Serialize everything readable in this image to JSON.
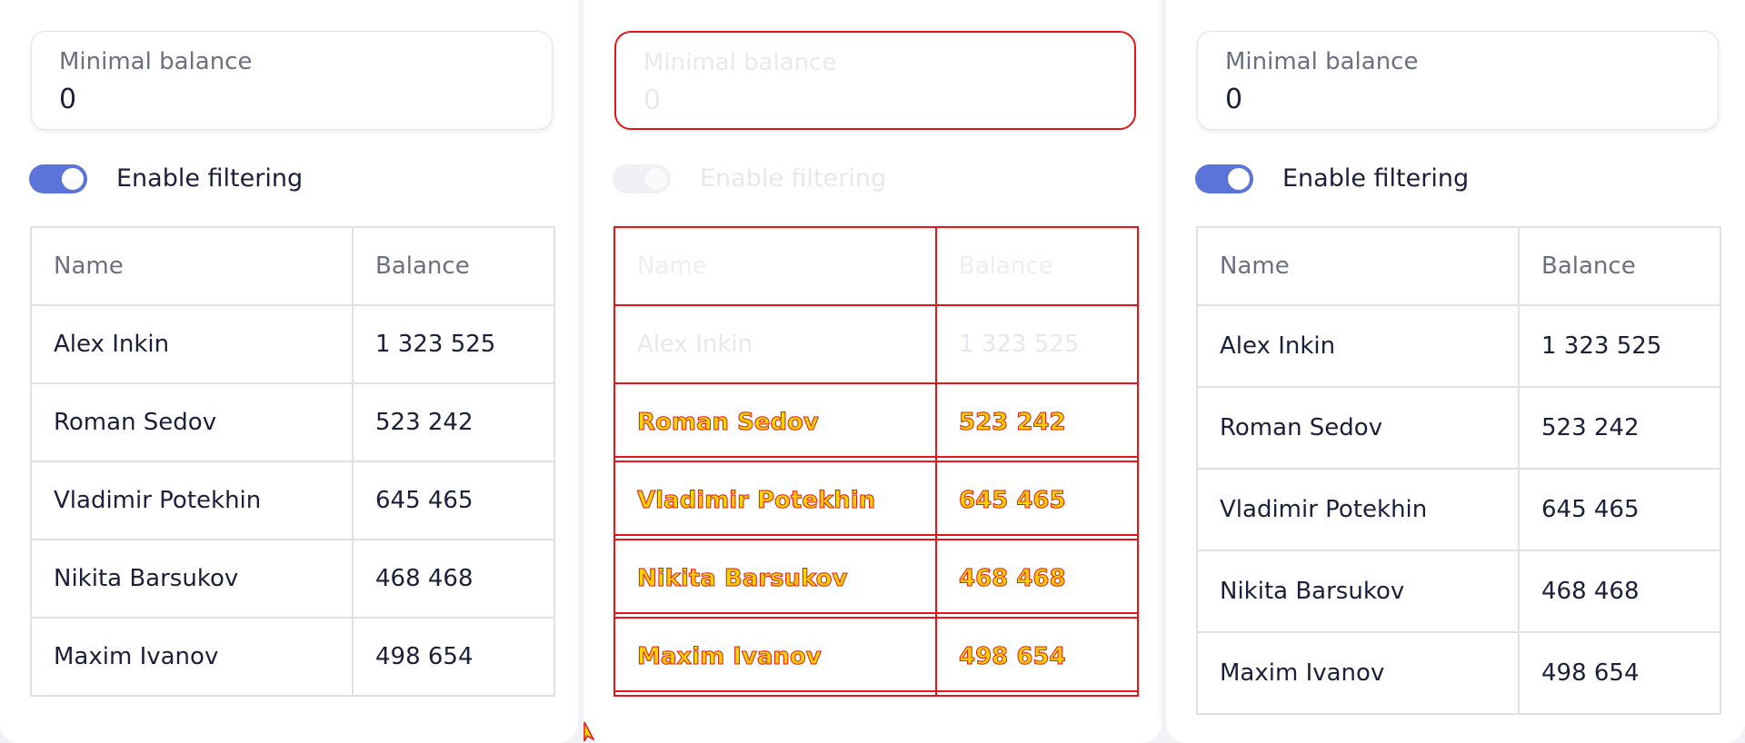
{
  "panels": [
    {
      "input_label": "Minimal balance",
      "input_value": "0",
      "toggle_label": "Enable filtering",
      "headers": [
        "Name",
        "Balance"
      ],
      "rows": [
        {
          "name": "Alex Inkin",
          "balance": "1 323 525"
        },
        {
          "name": "Roman Sedov",
          "balance": "523 242"
        },
        {
          "name": "Vladimir Potekhin",
          "balance": "645 465"
        },
        {
          "name": "Nikita Barsukov",
          "balance": "468 468"
        },
        {
          "name": "Maxim Ivanov",
          "balance": "498 654"
        }
      ]
    },
    {
      "input_label": "Minimal balance",
      "input_value": "0",
      "toggle_label": "Enable filtering",
      "headers": [
        "Name",
        "Balance"
      ],
      "rows": [
        {
          "name": "Alex Inkin",
          "balance": "1 323 525"
        },
        {
          "name": "Roman Sedov",
          "balance": "523 242"
        },
        {
          "name": "Vladimir Potekhin",
          "balance": "645 465"
        },
        {
          "name": "Nikita Barsukov",
          "balance": "468 468"
        },
        {
          "name": "Maxim Ivanov",
          "balance": "498 654"
        }
      ]
    },
    {
      "input_label": "Minimal balance",
      "input_value": "0",
      "toggle_label": "Enable filtering",
      "headers": [
        "Name",
        "Balance"
      ],
      "rows": [
        {
          "name": "Alex Inkin",
          "balance": "1 323 525"
        },
        {
          "name": "Roman Sedov",
          "balance": "523 242"
        },
        {
          "name": "Vladimir Potekhin",
          "balance": "645 465"
        },
        {
          "name": "Nikita Barsukov",
          "balance": "468 468"
        },
        {
          "name": "Maxim Ivanov",
          "balance": "498 654"
        }
      ]
    }
  ],
  "colors": {
    "toggle_on": "#5b74d9",
    "diff_outline": "#e8141a",
    "diff_fill": "#f7d300",
    "text_primary": "#1b1f3b",
    "text_secondary": "#6b6f80",
    "border": "#dfe1e6"
  },
  "toggles": [
    {
      "state": "on"
    },
    {
      "state": "on"
    },
    {
      "state": "on"
    }
  ]
}
